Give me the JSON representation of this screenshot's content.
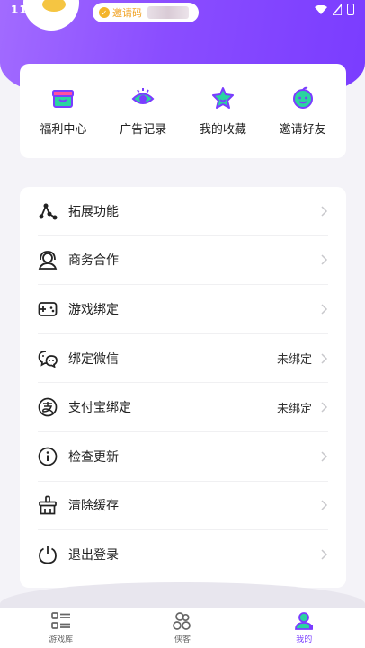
{
  "status_bar": {
    "time": "11:4"
  },
  "profile": {
    "invite_label": "邀请码"
  },
  "quick_actions": [
    {
      "label": "福利中心",
      "icon": "gift-icon"
    },
    {
      "label": "广告记录",
      "icon": "eye-icon"
    },
    {
      "label": "我的收藏",
      "icon": "star-icon"
    },
    {
      "label": "邀请好友",
      "icon": "smile-face-icon"
    }
  ],
  "menu": [
    {
      "label": "拓展功能",
      "value": "",
      "icon": "share-nodes-icon"
    },
    {
      "label": "商务合作",
      "value": "",
      "icon": "headset-icon"
    },
    {
      "label": "游戏绑定",
      "value": "",
      "icon": "gamepad-icon"
    },
    {
      "label": "绑定微信",
      "value": "未绑定",
      "icon": "wechat-icon"
    },
    {
      "label": "支付宝绑定",
      "value": "未绑定",
      "icon": "alipay-icon"
    },
    {
      "label": "检查更新",
      "value": "",
      "icon": "info-icon"
    },
    {
      "label": "清除缓存",
      "value": "",
      "icon": "broom-icon"
    },
    {
      "label": "退出登录",
      "value": "",
      "icon": "power-icon"
    }
  ],
  "tabs": [
    {
      "label": "游戏库",
      "icon": "list-icon",
      "active": false
    },
    {
      "label": "侠客",
      "icon": "people-icon",
      "active": false
    },
    {
      "label": "我的",
      "icon": "user-icon",
      "active": true
    }
  ],
  "colors": {
    "brand": "#7a3cff",
    "accent_green": "#2ad4a0",
    "accent_pink": "#ff4fa0"
  }
}
